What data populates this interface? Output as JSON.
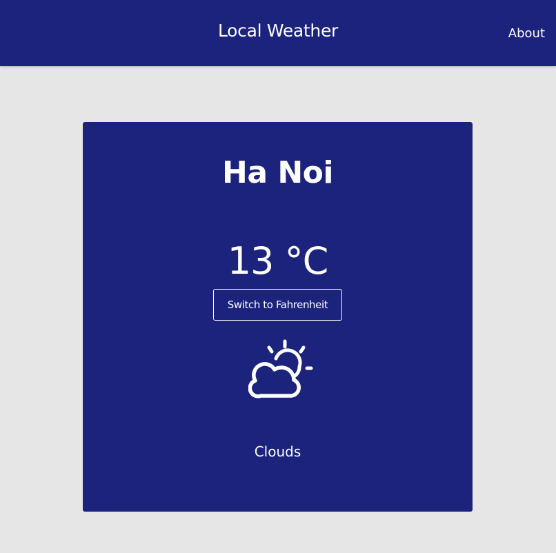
{
  "navbar": {
    "title": "Local Weather",
    "about_label": "About"
  },
  "weather": {
    "city": "Ha Noi",
    "temperature": "13 °C",
    "switch_button_label": "Switch to Fahrenheit",
    "condition": "Clouds",
    "icon": "partly-cloudy-icon"
  },
  "colors": {
    "primary": "#1b237d",
    "background": "#e6e6e6",
    "text": "#ffffff"
  }
}
